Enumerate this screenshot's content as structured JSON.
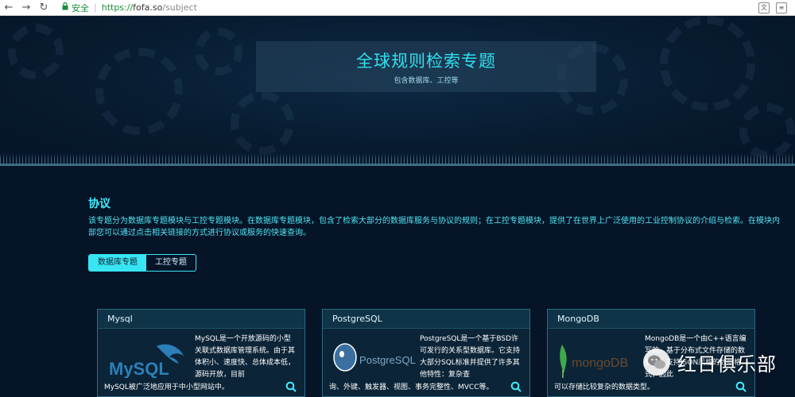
{
  "browser": {
    "back": "←",
    "forward": "→",
    "reload": "↻",
    "secure_label": "安全",
    "url_scheme": "https://",
    "url_host": "fofa.so",
    "url_path": "/subject"
  },
  "hero": {
    "title": "全球规则检索专题",
    "subtitle": "包含数据库、工控等"
  },
  "section": {
    "title": "协议",
    "description": "该专题分为数据库专题模块与工控专题模块。在数据库专题模块，包含了检索大部分的数据库服务与协议的规则；在工控专题模块，提供了在世界上广泛使用的工业控制协议的介绍与检索。在模块内部您可以通过点击相关链接的方式进行协议或服务的快速查询。"
  },
  "tabs": [
    {
      "label": "数据库专题",
      "active": true
    },
    {
      "label": "工控专题",
      "active": false
    }
  ],
  "cards": [
    {
      "title": "Mysql",
      "logo_text": "MySQL",
      "text": "MySQL是一个开放源码的小型关联式数据库管理系统。由于其体积小、速度快、总体成本低，源码开放，目前",
      "foot": "MySQL被广泛地应用于中小型网站中。"
    },
    {
      "title": "PostgreSQL",
      "logo_text": "PostgreSQL",
      "text": "PostgreSQL是一个基于BSD许可发行的关系型数据库。它支持大部分SQL标准并提供了许多其他特性：复杂查",
      "foot": "询、外键、触发器、视图、事务完整性、MVCC等。"
    },
    {
      "title": "MongoDB",
      "logo_text": "mongoDB",
      "text": "MongoDB是一个由C++语言编写的，基于分布式文件存储的数据库，支持JSON风格的数据格式，因此",
      "foot": "可以存储比较复杂的数据类型。"
    }
  ],
  "watermark": {
    "text": "红日俱乐部"
  },
  "colors": {
    "accent": "#38e6f3",
    "background": "#061428"
  }
}
